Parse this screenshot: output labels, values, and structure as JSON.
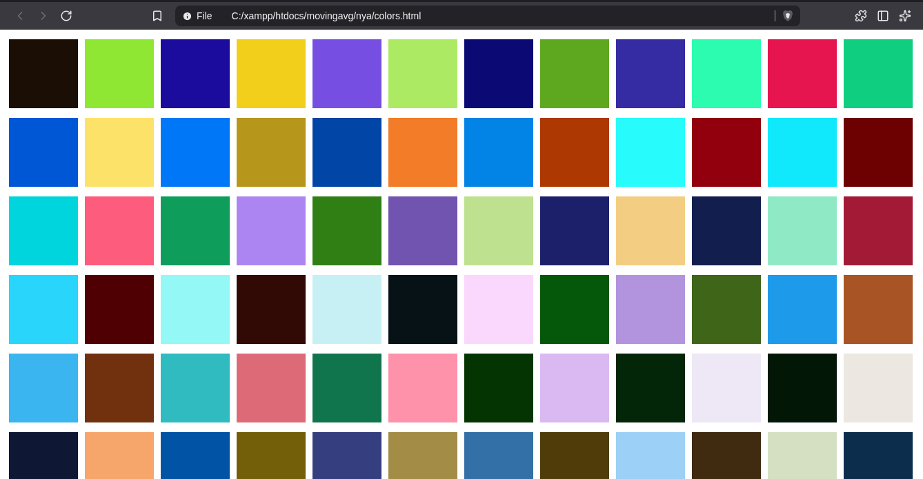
{
  "toolbar": {
    "file_label": "File",
    "url": "C:/xampp/htdocs/movingavg/nya/colors.html"
  },
  "swatches": [
    {
      "color": "#1b0e04"
    },
    {
      "color": "#8fe734"
    },
    {
      "color": "#1c0c9e"
    },
    {
      "color": "#f2cf1a"
    },
    {
      "color": "#774ee2"
    },
    {
      "color": "#abea62"
    },
    {
      "color": "#0b0a75"
    },
    {
      "color": "#5ea81f"
    },
    {
      "color": "#352ca4"
    },
    {
      "color": "#2bfcb0"
    },
    {
      "color": "#e6144f"
    },
    {
      "color": "#0fce7f"
    },
    {
      "color": "#0057d6"
    },
    {
      "color": "#fde26a"
    },
    {
      "color": "#0077f6"
    },
    {
      "color": "#b6961b"
    },
    {
      "color": "#0145a6"
    },
    {
      "color": "#f27c28"
    },
    {
      "color": "#0284e6"
    },
    {
      "color": "#ae3801"
    },
    {
      "color": "#28fbfb"
    },
    {
      "color": "#91000c"
    },
    {
      "color": "#10e8fb"
    },
    {
      "color": "#6d0000"
    },
    {
      "color": "#00d4dc"
    },
    {
      "color": "#fe5c7c"
    },
    {
      "color": "#0f9d5c"
    },
    {
      "color": "#ad85f3"
    },
    {
      "color": "#2f7f14"
    },
    {
      "color": "#7153b0"
    },
    {
      "color": "#bee18f"
    },
    {
      "color": "#1c206b"
    },
    {
      "color": "#f3ce82"
    },
    {
      "color": "#111e4e"
    },
    {
      "color": "#90e9c5"
    },
    {
      "color": "#a31a37"
    },
    {
      "color": "#2ad5fb"
    },
    {
      "color": "#4e0003"
    },
    {
      "color": "#93f8f6"
    },
    {
      "color": "#310a05"
    },
    {
      "color": "#c6f0f4"
    },
    {
      "color": "#071217"
    },
    {
      "color": "#fad7fc"
    },
    {
      "color": "#05570a"
    },
    {
      "color": "#b194dd"
    },
    {
      "color": "#3f6519"
    },
    {
      "color": "#1d9bea"
    },
    {
      "color": "#a85424"
    },
    {
      "color": "#3bb5ef"
    },
    {
      "color": "#71310e"
    },
    {
      "color": "#2fbbc0"
    },
    {
      "color": "#dd6a77"
    },
    {
      "color": "#10754d"
    },
    {
      "color": "#fe92ab"
    },
    {
      "color": "#043402"
    },
    {
      "color": "#dab9f3"
    },
    {
      "color": "#032608"
    },
    {
      "color": "#ede7f6"
    },
    {
      "color": "#031707"
    },
    {
      "color": "#ece7e1"
    },
    {
      "color": "#0e1835"
    },
    {
      "color": "#f6a66b"
    },
    {
      "color": "#0154a5"
    },
    {
      "color": "#735f09"
    },
    {
      "color": "#353f7f"
    },
    {
      "color": "#a38c45"
    },
    {
      "color": "#3370a7"
    },
    {
      "color": "#4f3c09"
    },
    {
      "color": "#9cd0f6"
    },
    {
      "color": "#402a10"
    },
    {
      "color": "#d5e0c3"
    },
    {
      "color": "#0c2e4c"
    }
  ]
}
